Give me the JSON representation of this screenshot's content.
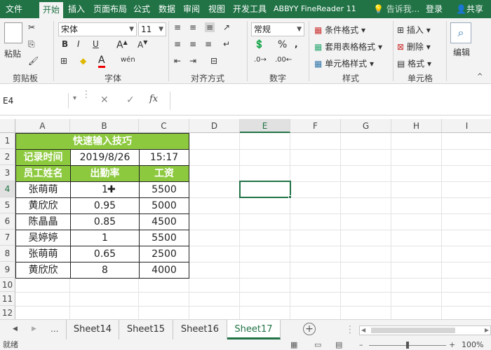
{
  "tabs": [
    "文件",
    "开始",
    "插入",
    "页面布局",
    "公式",
    "数据",
    "审阅",
    "视图",
    "开发工具",
    "ABBYY FineReader 11"
  ],
  "tell_me": "告诉我...",
  "login": "登录",
  "share": "共享",
  "ribbon": {
    "paste": "粘贴",
    "clipboard_label": "剪贴板",
    "font_name": "宋体",
    "font_size": "11",
    "font_label": "字体",
    "align_label": "对齐方式",
    "number_format": "常规",
    "number_label": "数字",
    "cond_format": "条件格式",
    "table_format": "套用表格格式",
    "cell_style": "单元格样式",
    "style_label": "样式",
    "insert": "插入",
    "delete": "删除",
    "format": "格式",
    "cells_label": "单元格",
    "edit": "编辑",
    "font_color_letter": "A",
    "bold": "B",
    "italic": "I",
    "underline": "U",
    "wen": "wén"
  },
  "formula": {
    "name_box": "E4",
    "fx": "fx",
    "value": ""
  },
  "columns": [
    "A",
    "B",
    "C",
    "D",
    "E",
    "F",
    "G",
    "H",
    "I"
  ],
  "rows": [
    "1",
    "2",
    "3",
    "4",
    "5",
    "6",
    "7",
    "8",
    "9",
    "10",
    "11",
    "12"
  ],
  "table": {
    "title": "快速输入技巧",
    "record_label": "记录时间",
    "record_date": "2019/8/26",
    "record_time": "15:17",
    "headers": [
      "员工姓名",
      "出勤率",
      "工资"
    ],
    "data": [
      [
        "张萌萌",
        "1",
        "5500"
      ],
      [
        "黄欣欣",
        "0.95",
        "5000"
      ],
      [
        "陈晶晶",
        "0.85",
        "4500"
      ],
      [
        "吴婷婷",
        "1",
        "5500"
      ],
      [
        "张萌萌",
        "0.65",
        "2500"
      ],
      [
        "黄欣欣",
        "8",
        "4000"
      ]
    ]
  },
  "sheets": {
    "more": "...",
    "list": [
      "Sheet14",
      "Sheet15",
      "Sheet16",
      "Sheet17"
    ],
    "active": "Sheet17"
  },
  "status": {
    "ready": "就绪",
    "zoom": "100%"
  },
  "colors": {
    "excel_green": "#217346",
    "header_fill": "#8dc93e"
  }
}
